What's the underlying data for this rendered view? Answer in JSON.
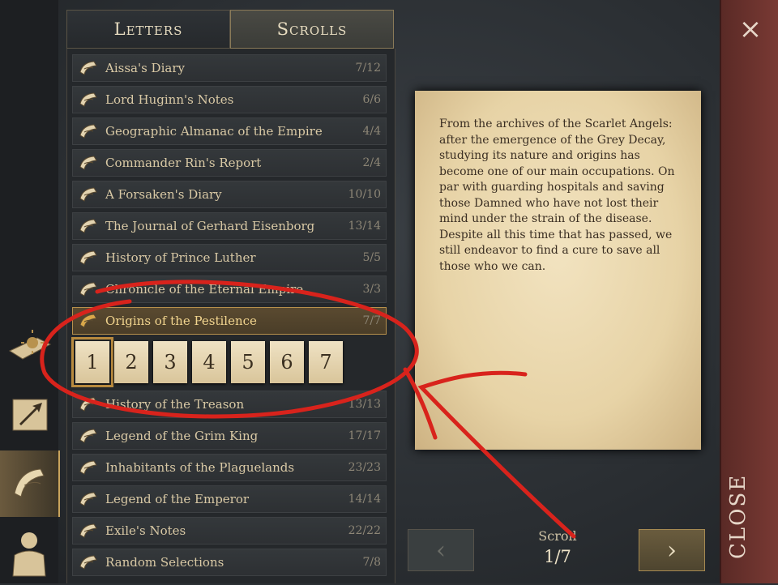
{
  "tabs": [
    {
      "label": "Letters",
      "active": false
    },
    {
      "label": "Scrolls",
      "active": true
    }
  ],
  "items": [
    {
      "title": "Aissa's Diary",
      "count": "7/12"
    },
    {
      "title": "Lord Huginn's Notes",
      "count": "6/6"
    },
    {
      "title": "Geographic Almanac of the Empire",
      "count": "4/4"
    },
    {
      "title": "Commander Rin's Report",
      "count": "2/4"
    },
    {
      "title": "A Forsaken's Diary",
      "count": "10/10"
    },
    {
      "title": "The Journal of Gerhard Eisenborg",
      "count": "13/14"
    },
    {
      "title": "History of Prince Luther",
      "count": "5/5"
    },
    {
      "title": "Chronicle of the Eternal Empire",
      "count": "3/3"
    },
    {
      "title": "Origins of the Pestilence",
      "count": "7/7"
    },
    {
      "title": "History of the Treason",
      "count": "13/13"
    },
    {
      "title": "Legend of the Grim King",
      "count": "17/17"
    },
    {
      "title": "Inhabitants of the Plaguelands",
      "count": "23/23"
    },
    {
      "title": "Legend of the Emperor",
      "count": "14/14"
    },
    {
      "title": "Exile's Notes",
      "count": "22/22"
    },
    {
      "title": "Random Selections",
      "count": "7/8"
    }
  ],
  "selected_index": 8,
  "pages": [
    "1",
    "2",
    "3",
    "4",
    "5",
    "6",
    "7"
  ],
  "selected_page": 0,
  "reader": {
    "text": "From the archives of the Scarlet Angels: after the emergence of the Grey Decay, studying its nature and origins has become one of our main occupations. On par with guarding hospitals and saving those Damned who have not lost their mind under the strain of the disease. Despite all this time that has passed, we still endeavor to find a cure to save all those who we can.",
    "scroll_label": "Scroll",
    "scroll_number": "1/7"
  },
  "nav": {
    "prev": "‹",
    "next": "›"
  },
  "close": {
    "label": "CLOSE",
    "icon": "×"
  },
  "rail": [
    "sun-book-icon",
    "map-arrow-icon",
    "scroll-quill-icon",
    "hero-bust-icon"
  ],
  "colors": {
    "accent": "#c9a45c",
    "close_panel": "#7a3a34",
    "annotation": "#d8231c"
  }
}
